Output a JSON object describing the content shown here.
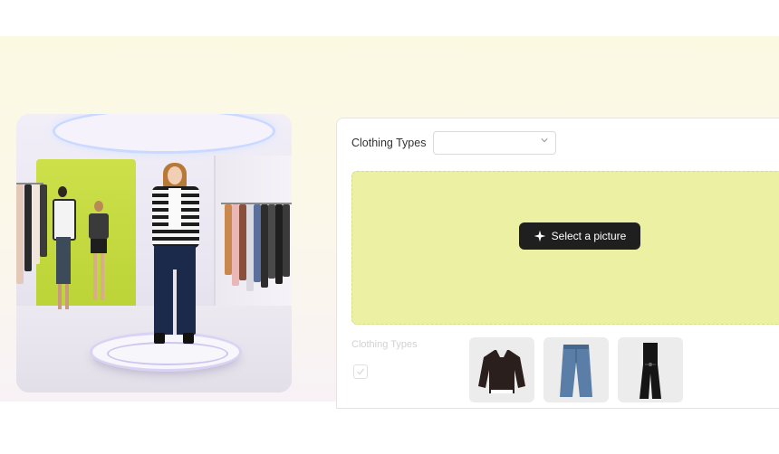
{
  "panel": {
    "clothing_types_label": "Clothing Types",
    "clothing_types_value": "",
    "select_button_label": "Select a picture",
    "secondary_label": "Clothing Types"
  },
  "scene": {
    "icon": "fashion-store-scene-image"
  },
  "thumbnails": [
    {
      "name": "sweater-thumbnail",
      "icon": "sweater-icon"
    },
    {
      "name": "jeans-thumbnail",
      "icon": "jeans-icon"
    },
    {
      "name": "jumpsuit-thumbnail",
      "icon": "jumpsuit-icon"
    }
  ],
  "colors": {
    "dropzone": "#ecf0a2",
    "button": "#1f1f1f",
    "accent_wall": "#c7db3f"
  }
}
